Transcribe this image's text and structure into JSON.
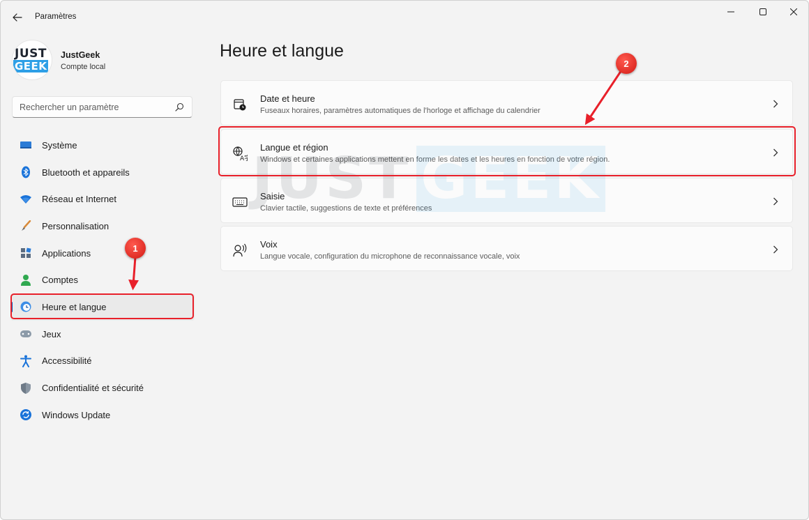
{
  "window": {
    "title": "Paramètres",
    "controls": [
      "minimize-icon",
      "maximize-icon",
      "close-icon"
    ]
  },
  "profile": {
    "name": "JustGeek",
    "account_type": "Compte local",
    "logo_line1": "JUST",
    "logo_line2": "GEEK"
  },
  "search": {
    "placeholder": "Rechercher un paramètre"
  },
  "sidebar": {
    "items": [
      {
        "label": "Système",
        "icon": "monitor-icon"
      },
      {
        "label": "Bluetooth et appareils",
        "icon": "bluetooth-icon"
      },
      {
        "label": "Réseau et Internet",
        "icon": "wifi-icon"
      },
      {
        "label": "Personnalisation",
        "icon": "brush-icon"
      },
      {
        "label": "Applications",
        "icon": "apps-icon"
      },
      {
        "label": "Comptes",
        "icon": "person-icon"
      },
      {
        "label": "Heure et langue",
        "icon": "globe-clock-icon",
        "active": true
      },
      {
        "label": "Jeux",
        "icon": "gamepad-icon"
      },
      {
        "label": "Accessibilité",
        "icon": "accessibility-icon"
      },
      {
        "label": "Confidentialité et sécurité",
        "icon": "shield-icon"
      },
      {
        "label": "Windows Update",
        "icon": "update-icon"
      }
    ]
  },
  "main": {
    "title": "Heure et langue",
    "cards": [
      {
        "title": "Date et heure",
        "description": "Fuseaux horaires, paramètres automatiques de l'horloge et affichage du calendrier",
        "icon": "calendar-clock-icon"
      },
      {
        "title": "Langue et région",
        "description": "Windows et certaines applications mettent en forme les dates et les heures en fonction de votre région.",
        "icon": "language-icon"
      },
      {
        "title": "Saisie",
        "description": "Clavier tactile, suggestions de texte et préférences",
        "icon": "keyboard-icon"
      },
      {
        "title": "Voix",
        "description": "Langue vocale, configuration du microphone de reconnaissance vocale, voix",
        "icon": "speech-icon"
      }
    ]
  },
  "annotations": {
    "badge1": "1",
    "badge2": "2",
    "accent_color": "#e8202a"
  },
  "watermark": {
    "part1": "JUST",
    "part2": "GEEK"
  },
  "colors": {
    "accent": "#005fb8",
    "background": "#f3f3f3",
    "card": "#fbfbfb",
    "annotation": "#e8202a",
    "brand_blue": "#2e9fe6"
  }
}
